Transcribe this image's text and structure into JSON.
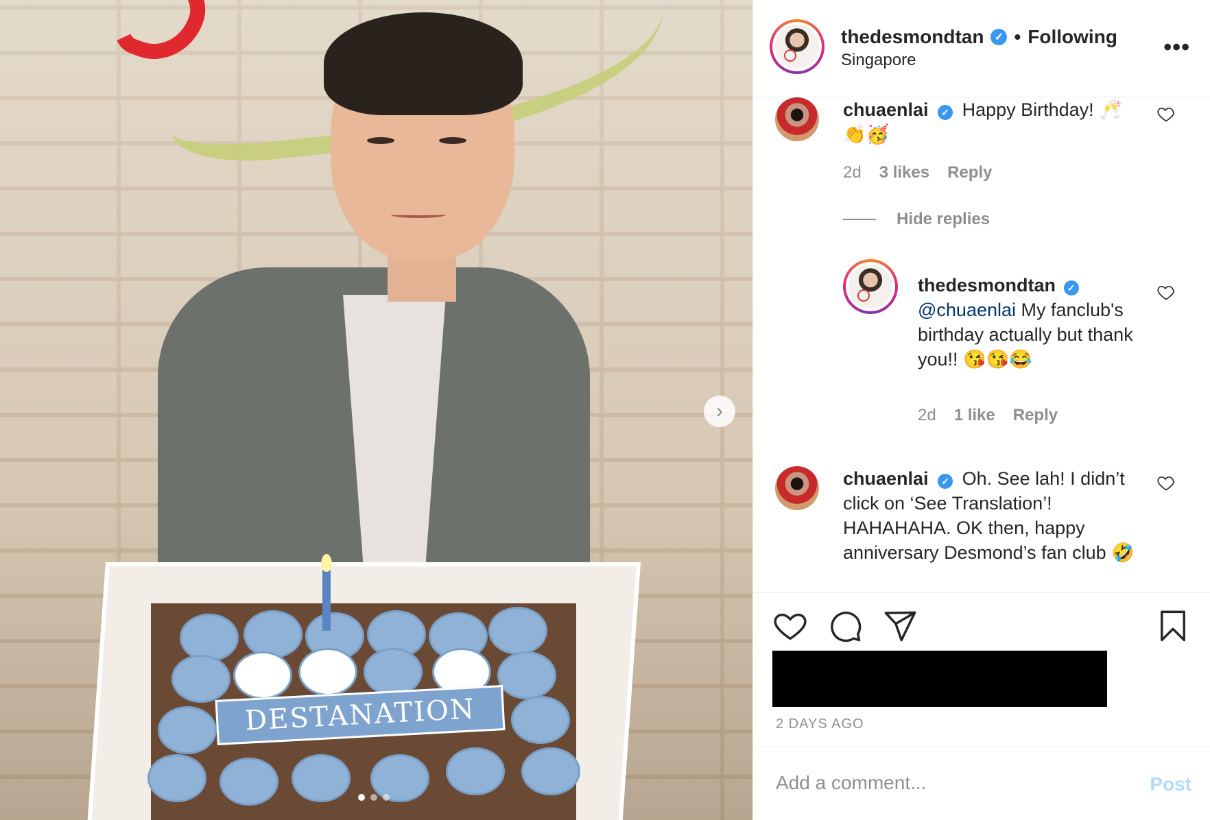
{
  "post": {
    "image_alt": "",
    "carousel": {
      "total": 3,
      "current": 1
    },
    "cake": {
      "banner_text": "DESTANATION"
    }
  },
  "header": {
    "username": "thedesmondtan",
    "separator": "•",
    "follow_status": "Following",
    "location": "Singapore",
    "more_icon": "more-horizontal-icon"
  },
  "comments": [
    {
      "username": "chuaenlai",
      "text": "Happy Birthday! 🥂 👏🥳",
      "time": "2d",
      "likes": "3 likes",
      "reply_label": "Reply"
    },
    {
      "username": "chuaenlai",
      "text": "Oh. See lah! I didn’t click on ‘See Translation’! HAHAHAHA. OK then, happy anniversary Desmond’s fan club 🤣"
    }
  ],
  "hide_replies_label": "Hide replies",
  "reply": {
    "username": "thedesmondtan",
    "mention": "@chuaenlai",
    "text": " My fanclub's birthday actually but thank you!! 😘😘😂",
    "time": "2d",
    "likes": "1 like",
    "reply_label": "Reply"
  },
  "actions": {
    "timestamp": "2 DAYS AGO",
    "comment_placeholder": "Add a comment...",
    "post_label": "Post"
  },
  "colors": {
    "verified": "#3897f0",
    "muted": "#8e8e8e",
    "post_disabled": "#b3dbff",
    "mention": "#00376b"
  }
}
